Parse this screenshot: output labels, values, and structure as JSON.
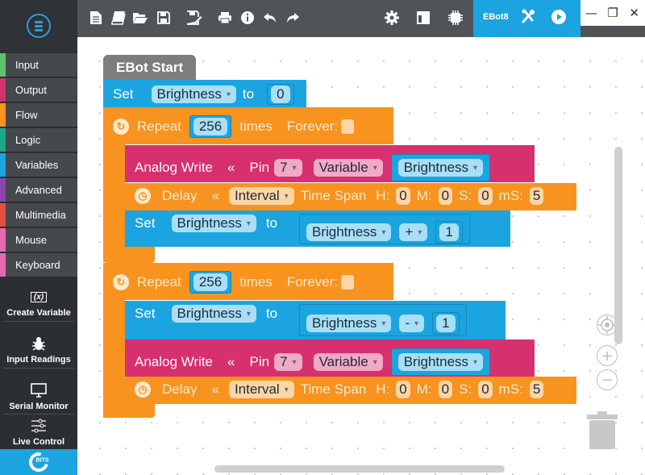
{
  "app": {
    "logo": "ebot-logo"
  },
  "toolbar": {
    "icons": [
      "new-file-icon",
      "open-book-icon",
      "open-folder-icon",
      "save-icon",
      "save-as-icon",
      "print-icon",
      "info-icon",
      "undo-icon",
      "redo-icon",
      "settings-gear-icon",
      "layout-icon",
      "chip-icon",
      "tools-icon",
      "play-icon"
    ],
    "robot_name": "EBot8"
  },
  "window_controls": {
    "minimize": "—",
    "restore": "❐",
    "close": "✕"
  },
  "sidebar": {
    "categories": [
      {
        "label": "Input",
        "color": "#5cc56a"
      },
      {
        "label": "Output",
        "color": "#d6306e"
      },
      {
        "label": "Flow",
        "color": "#f7931e"
      },
      {
        "label": "Logic",
        "color": "#1aa88a"
      },
      {
        "label": "Variables",
        "color": "#1ba4e0"
      },
      {
        "label": "Advanced",
        "color": "#8e44ad"
      },
      {
        "label": "Multimedia",
        "color": "#e74c3c"
      },
      {
        "label": "Mouse",
        "color": "#e868b0"
      },
      {
        "label": "Keyboard",
        "color": "#e868b0"
      }
    ],
    "tools": [
      {
        "label": "Create Variable",
        "icon": "variable-icon",
        "glyph": "(x)"
      },
      {
        "label": "Input Readings",
        "icon": "bug-icon",
        "glyph": "🕷"
      },
      {
        "label": "Serial Monitor",
        "icon": "monitor-icon",
        "glyph": "🖥"
      },
      {
        "label": "Live Control",
        "icon": "sliders-icon",
        "glyph": "⚟"
      }
    ],
    "footer_brand": "BITS"
  },
  "program": {
    "start": {
      "label": "EBot Start"
    },
    "set_initial": {
      "keyword": "Set",
      "variable": "Brightness",
      "to": "to",
      "value": "0"
    },
    "loops": [
      {
        "keyword": "Repeat",
        "count": "256",
        "times": "times",
        "forever": "Forever:",
        "analog_write": {
          "keyword": "Analog Write",
          "arrow": "«",
          "pin_label": "Pin",
          "pin": "7",
          "mode": "Variable",
          "variable": "Brightness"
        },
        "delay": {
          "keyword": "Delay",
          "arrow": "«",
          "mode": "Interval",
          "span": "Time Span",
          "h_label": "H:",
          "h": "0",
          "m_label": "M:",
          "m": "0",
          "s_label": "S:",
          "s": "0",
          "ms_label": "mS:",
          "ms": "5"
        },
        "set": {
          "keyword": "Set",
          "variable": "Brightness",
          "to": "to",
          "operand": "Brightness",
          "operator": "+",
          "value": "1"
        }
      },
      {
        "keyword": "Repeat",
        "count": "256",
        "times": "times",
        "forever": "Forever:",
        "set": {
          "keyword": "Set",
          "variable": "Brightness",
          "to": "to",
          "operand": "Brightness",
          "operator": "-",
          "value": "1"
        },
        "analog_write": {
          "keyword": "Analog Write",
          "arrow": "«",
          "pin_label": "Pin",
          "pin": "7",
          "mode": "Variable",
          "variable": "Brightness"
        },
        "delay": {
          "keyword": "Delay",
          "arrow": "«",
          "mode": "Interval",
          "span": "Time Span",
          "h_label": "H:",
          "h": "0",
          "m_label": "M:",
          "m": "0",
          "s_label": "S:",
          "s": "0",
          "ms_label": "mS:",
          "ms": "5"
        }
      }
    ]
  },
  "workspace_controls": {
    "center": "recenter-icon",
    "zoom_in": "+",
    "zoom_out": "−",
    "trash": "trash-icon"
  }
}
